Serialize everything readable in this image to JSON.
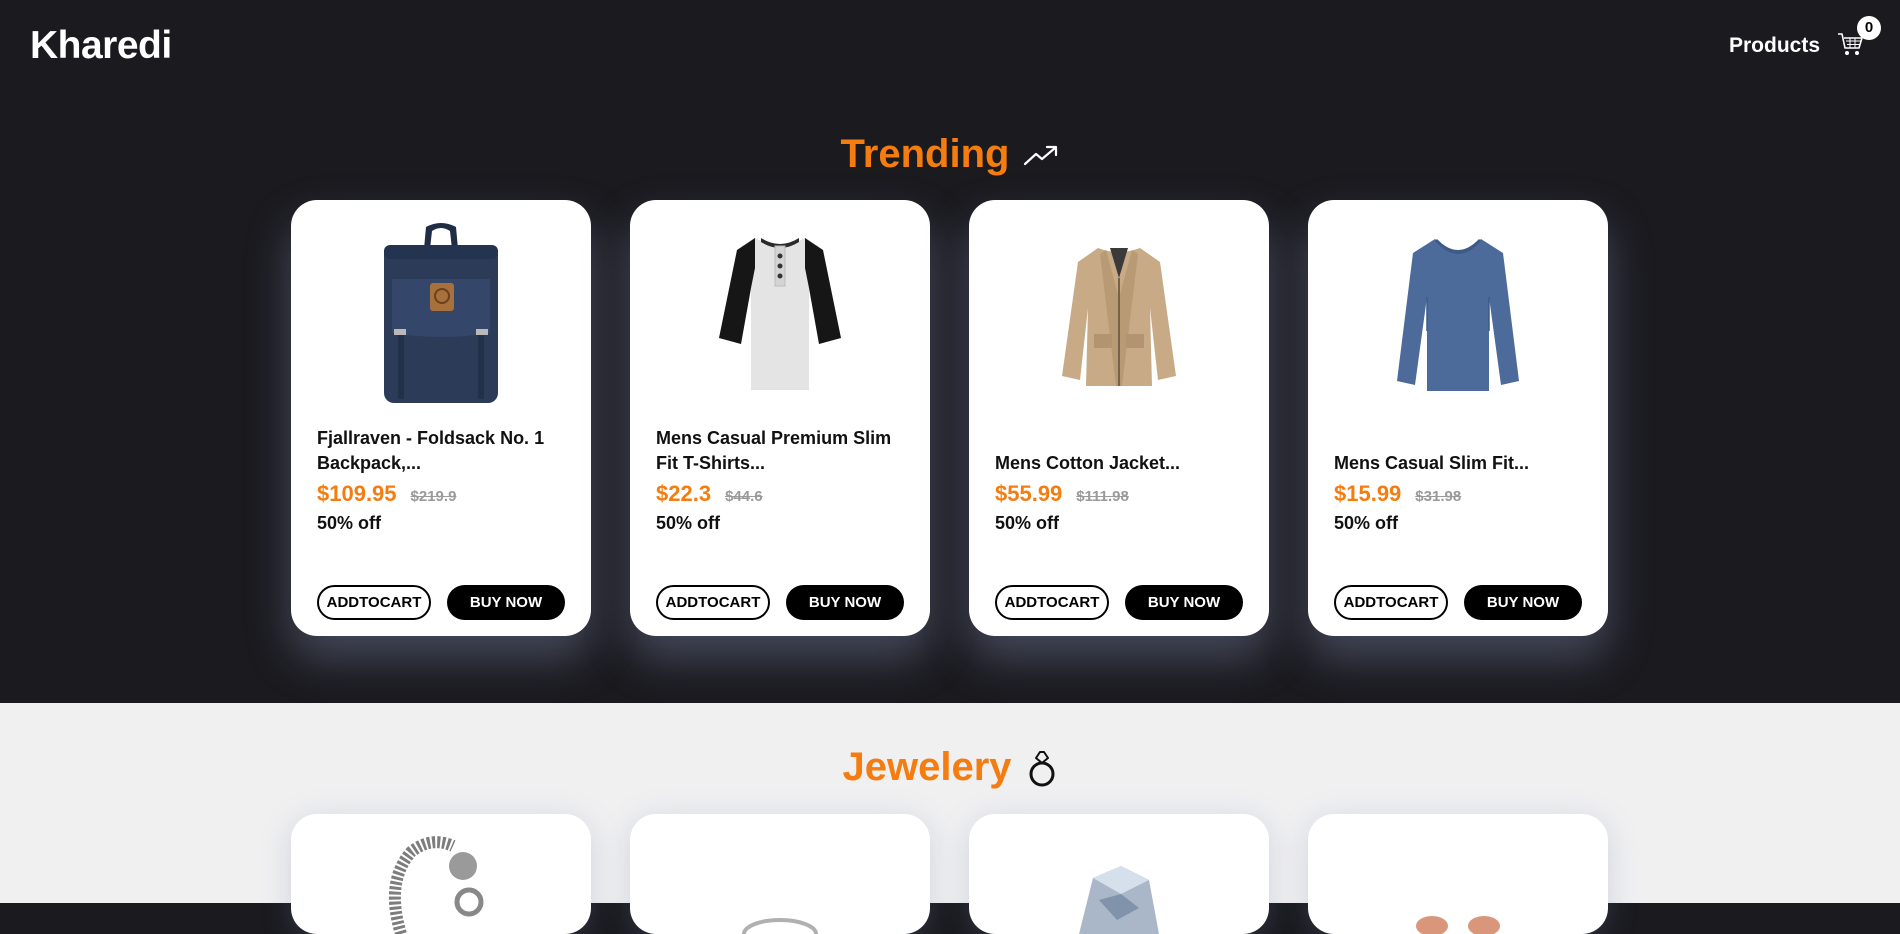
{
  "header": {
    "logo": "Kharedi",
    "nav_products": "Products",
    "cart_count": "0",
    "cart_icon": "shopping-cart-icon"
  },
  "trending": {
    "title": "Trending",
    "icon": "trending-up-icon",
    "products": [
      {
        "name": "Fjallraven - Foldsack No. 1 Backpack,...",
        "price": "$109.95",
        "old_price": "$219.9",
        "discount": "50% off",
        "add_label": "ADDTOCART",
        "buy_label": "BUY NOW",
        "image": "backpack-image"
      },
      {
        "name": "Mens Casual Premium Slim Fit T-Shirts...",
        "price": "$22.3",
        "old_price": "$44.6",
        "discount": "50% off",
        "add_label": "ADDTOCART",
        "buy_label": "BUY NOW",
        "image": "tshirt-image"
      },
      {
        "name": "Mens Cotton Jacket...",
        "price": "$55.99",
        "old_price": "$111.98",
        "discount": "50% off",
        "add_label": "ADDTOCART",
        "buy_label": "BUY NOW",
        "image": "jacket-image"
      },
      {
        "name": "Mens Casual Slim Fit...",
        "price": "$15.99",
        "old_price": "$31.98",
        "discount": "50% off",
        "add_label": "ADDTOCART",
        "buy_label": "BUY NOW",
        "image": "longsleeve-image"
      }
    ]
  },
  "jewelery": {
    "title": "Jewelery",
    "icon": "ring-icon",
    "products": [
      {
        "image": "bracelet-image"
      },
      {
        "image": "ring-image"
      },
      {
        "image": "gem-ring-image"
      },
      {
        "image": "earrings-image"
      }
    ]
  },
  "colors": {
    "dark_bg": "#1a1a1f",
    "accent": "#f57c0f",
    "light_bg": "#f0f0f1"
  }
}
